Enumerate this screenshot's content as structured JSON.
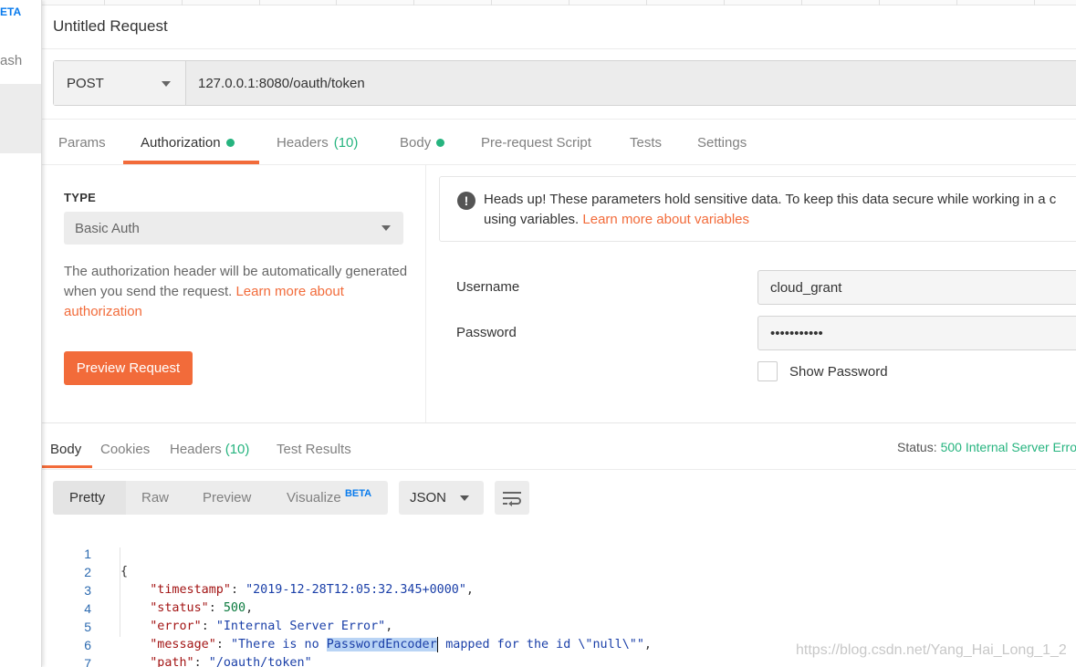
{
  "sidebar": {
    "beta_badge": "ETA",
    "partial_label": "ash"
  },
  "request": {
    "title": "Untitled Request",
    "method": "POST",
    "url": "127.0.0.1:8080/oauth/token"
  },
  "tabs": {
    "params": "Params",
    "authorization": "Authorization",
    "headers": "Headers",
    "headers_count": "(10)",
    "body": "Body",
    "prerequest": "Pre-request Script",
    "tests": "Tests",
    "settings": "Settings"
  },
  "auth": {
    "type_label": "TYPE",
    "type_value": "Basic Auth",
    "description": "The authorization header will be automatically generated when you send the request.",
    "learn_more": "Learn more about authorization",
    "preview_button": "Preview Request",
    "notice_text": "Heads up! These parameters hold sensitive data. To keep this data secure while working in a c",
    "notice_text2": "using variables.",
    "notice_link": "Learn more about variables",
    "username_label": "Username",
    "username_value": "cloud_grant",
    "password_label": "Password",
    "password_value": "•••••••••••",
    "show_password_label": "Show Password"
  },
  "response": {
    "tabs": {
      "body": "Body",
      "cookies": "Cookies",
      "headers": "Headers",
      "headers_count": "(10)",
      "test_results": "Test Results"
    },
    "status_label": "Status:",
    "status_value": "500 Internal Server Erro",
    "views": {
      "pretty": "Pretty",
      "raw": "Raw",
      "preview": "Preview",
      "visualize": "Visualize",
      "visualize_badge": "BETA"
    },
    "format": "JSON",
    "lines": [
      "1",
      "2",
      "3",
      "4",
      "5",
      "6",
      "7"
    ],
    "code": {
      "open": "{",
      "close": "}",
      "timestamp_key": "\"timestamp\"",
      "timestamp_val": "\"2019-12-28T12:05:32.345+0000\"",
      "status_key": "\"status\"",
      "status_val": "500",
      "error_key": "\"error\"",
      "error_val": "\"Internal Server Error\"",
      "message_key": "\"message\"",
      "message_pre": "\"There is no ",
      "message_hl": "PasswordEncoder",
      "message_post": " mapped for the id \\\"null\\\"\"",
      "path_key": "\"path\"",
      "path_q1": "\"",
      "path_val": "/oauth/token",
      "path_q2": "\""
    }
  },
  "watermark": "https://blog.csdn.net/Yang_Hai_Long_1_2",
  "colors": {
    "accent": "#f26b3a",
    "success": "#26b47f",
    "beta": "#097bed"
  }
}
